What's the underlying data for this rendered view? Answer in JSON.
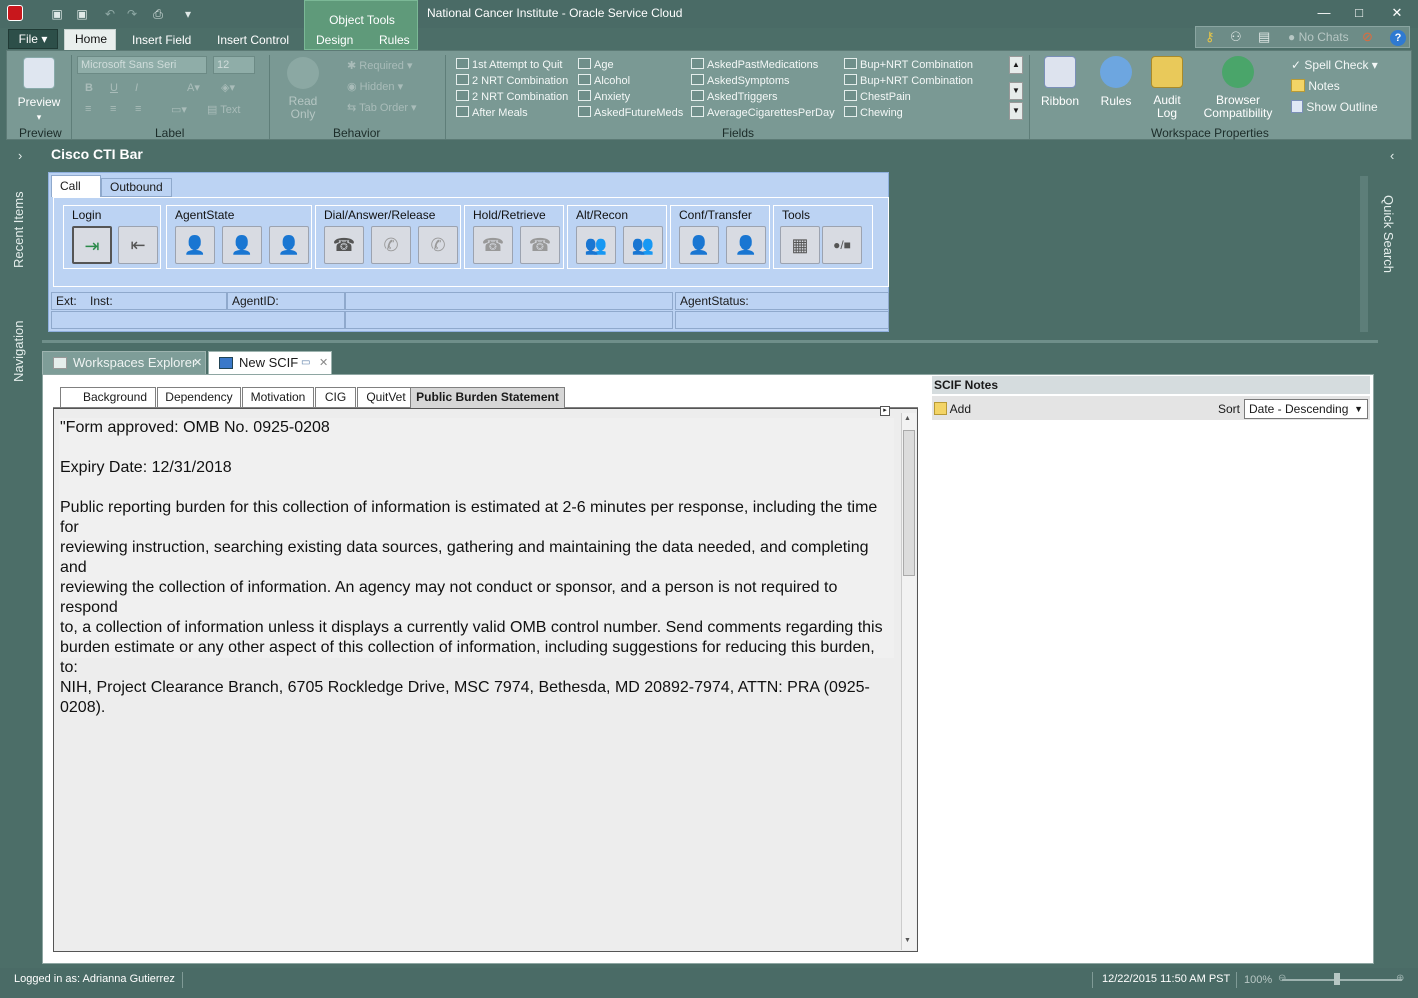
{
  "window": {
    "title": "National Cancer Institute  -  Oracle Service Cloud",
    "object_tools": "Object Tools",
    "chats": "No Chats"
  },
  "menu": {
    "file": "File",
    "tabs": [
      "Home",
      "Insert Field",
      "Insert Control",
      "Design",
      "Rules"
    ]
  },
  "ribbon": {
    "preview": {
      "label": "Preview",
      "group": "Preview"
    },
    "label_group": {
      "font": "Microsoft Sans Seri",
      "size": "12",
      "bold": "B",
      "underline": "U",
      "italic": "I",
      "text": "Text",
      "group": "Label"
    },
    "behavior": {
      "read_only": "Read Only",
      "required": "Required",
      "hidden": "Hidden",
      "tab_order": "Tab Order",
      "group": "Behavior"
    },
    "fields": {
      "group": "Fields",
      "items": [
        "1st Attempt to Quit",
        "2 NRT Combination",
        "2 NRT Combination",
        "After Meals",
        "Age",
        "Alcohol",
        "Anxiety",
        "AskedFutureMeds",
        "AskedPastMedications",
        "AskedSymptoms",
        "AskedTriggers",
        "AverageCigarettesPerDay",
        "Bup+NRT Combination",
        "Bup+NRT Combination",
        "ChestPain",
        "Chewing"
      ]
    },
    "workspace": {
      "group": "Workspace Properties",
      "ribbon": "Ribbon",
      "rules": "Rules",
      "audit_log": "Audit Log",
      "browser_compat": "Browser Compatibility",
      "spell_check": "Spell Check",
      "notes": "Notes",
      "show_outline": "Show Outline"
    }
  },
  "cti": {
    "title": "Cisco CTI Bar",
    "tabs": [
      "Call",
      "Outbound"
    ],
    "groups": [
      "Login",
      "AgentState",
      "Dial/Answer/Release",
      "Hold/Retrieve",
      "Alt/Recon",
      "Conf/Transfer",
      "Tools"
    ],
    "fields": {
      "ext": "Ext:",
      "inst": "Inst:",
      "agent_id": "AgentID:",
      "agent_status": "AgentStatus:"
    }
  },
  "sidebar": {
    "recent": "Recent Items",
    "navigation": "Navigation",
    "quick_search": "Quick Search"
  },
  "doc_tabs": [
    "Workspaces Explorer",
    "New SCIF"
  ],
  "sub_tabs": [
    "Background",
    "Dependency",
    "Motivation",
    "CIG",
    "QuitVet",
    "Public Burden Statement"
  ],
  "editor": {
    "line1": "\"Form approved: OMB No. 0925-0208",
    "line2": "Expiry Date:  12/31/2018",
    "paragraph": [
      "Public reporting burden for this collection of information is estimated at 2-6 minutes per response, including the time for",
      "reviewing instruction, searching existing data sources, gathering and maintaining the data needed, and completing and",
      "reviewing the collection of information. An agency may not conduct or sponsor, and a person is not required to respond",
      "to, a collection of information unless it displays a currently valid OMB control number. Send comments regarding this",
      "burden estimate or any other aspect of this collection of information, including suggestions for reducing this burden, to:",
      "NIH, Project Clearance Branch, 6705 Rockledge Drive, MSC 7974, Bethesda, MD 20892-7974, ATTN: PRA (0925-",
      "0208)."
    ]
  },
  "notes": {
    "title": "SCIF Notes",
    "add": "Add",
    "sort_label": "Sort",
    "sort_value": "Date - Descending"
  },
  "status": {
    "logged_in": "Logged in as: Adrianna Gutierrez",
    "datetime": "12/22/2015 11:50 AM PST",
    "zoom": "100%"
  }
}
